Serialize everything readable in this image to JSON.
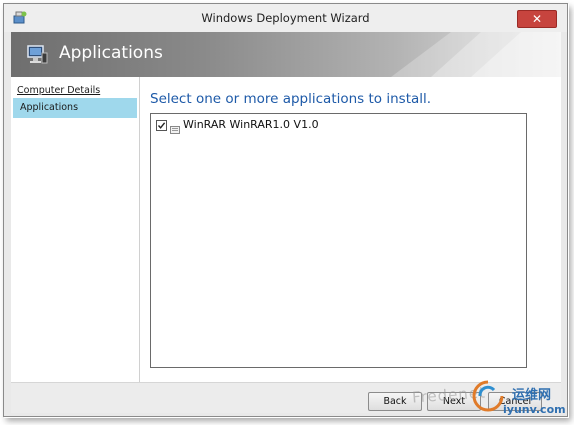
{
  "window": {
    "title": "Windows Deployment Wizard",
    "close_glyph": "✕"
  },
  "banner": {
    "title": "Applications",
    "icon": "computer-icon"
  },
  "sidebar": {
    "items": [
      {
        "label": "Computer Details",
        "state": "link"
      },
      {
        "label": "Applications",
        "state": "active"
      }
    ]
  },
  "main": {
    "heading": "Select one or more applications to install.",
    "applications": [
      {
        "label": "WinRAR WinRAR1.0 V1.0",
        "checked": true
      }
    ]
  },
  "footer": {
    "back_label": "Back",
    "next_label": "Next",
    "cancel_label": "Cancel"
  },
  "watermark": {
    "site_text": "Fredenet",
    "brand_cn": "运维网",
    "brand_domain": "iyunv.com"
  },
  "colors": {
    "heading": "#1e5aa8",
    "active_item": "#9fd8ec",
    "close_button": "#c7443e"
  }
}
